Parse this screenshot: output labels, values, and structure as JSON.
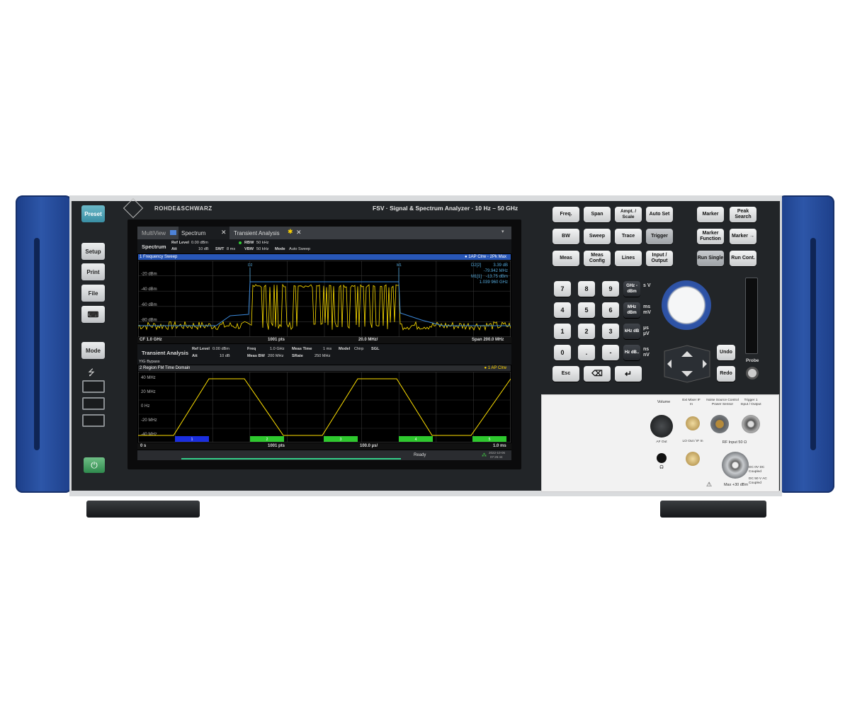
{
  "brand": "ROHDE&SCHWARZ",
  "model_title": "FSV · Signal & Spectrum Analyzer · 10 Hz – 50 GHz",
  "left_panel": {
    "preset": "Preset",
    "setup": "Setup",
    "print": "Print",
    "file": "File",
    "keyboard": "⌨",
    "mode": "Mode",
    "usb_symbol": "⭍"
  },
  "screen": {
    "tabs": [
      {
        "label": "MultiView"
      },
      {
        "label": "Spectrum"
      },
      {
        "label": "Transient Analysis"
      }
    ],
    "spectrum_header": {
      "name": "Spectrum",
      "ref_level_label": "Ref Level",
      "ref_level": "0.00 dBm",
      "att_label": "Att",
      "att": "10 dB",
      "swt_label": "SWT",
      "swt": "8 ms",
      "rbw_label": "RBW",
      "rbw": "50 kHz",
      "vbw_label": "VBW",
      "vbw": "50 kHz",
      "mode_label": "Mode",
      "mode": "Auto Sweep"
    },
    "win1": {
      "title": "1 Frequency Sweep",
      "trace_info": "● 1AP Clrw  ◦ 2Pk Max",
      "marker_readout": [
        [
          "D2[2]",
          "3.39 dB"
        ],
        [
          "",
          "-79.942 MHz"
        ],
        [
          "M1[1]",
          "-13.75 dBm"
        ],
        [
          "",
          "1.039 960 GHz"
        ]
      ],
      "y_ticks": [
        "-20 dBm",
        "-40 dBm",
        "-60 dBm",
        "-80 dBm"
      ],
      "marker_labels": [
        "D2",
        "M1"
      ],
      "footer": {
        "cf": "CF 1.0 GHz",
        "pts": "1001 pts",
        "div": "20.0 MHz/",
        "span": "Span 200.0 MHz"
      }
    },
    "transient_header": {
      "name": "Transient Analysis",
      "ref_level_label": "Ref Level",
      "ref_level": "0.00 dBm",
      "att_label": "Att",
      "att": "10 dB",
      "freq_label": "Freq",
      "freq": "1.0 GHz",
      "meas_bw_label": "Meas BW",
      "meas_bw": "200 MHz",
      "meas_time_label": "Meas Time",
      "meas_time": "1 ms",
      "srate_label": "SRate",
      "srate": "250 MHz",
      "model_label": "Model",
      "model": "Chirp",
      "sgl": "SGL",
      "yig": "YIG Bypass"
    },
    "win2": {
      "title": "2 Region FM Time Domain",
      "trace_info": "● 1 AP Clrw",
      "y_ticks": [
        "40 MHz",
        "20 MHz",
        "0 Hz",
        "-20 MHz",
        "-40 MHz"
      ],
      "regions": [
        "1",
        "2",
        "3",
        "4",
        "5"
      ],
      "footer": {
        "start": "0 s",
        "pts": "1001 pts",
        "div": "100.0 µs/",
        "stop": "1.0 ms"
      }
    },
    "status": {
      "ready": "Ready",
      "date": "2022-10-06",
      "time": "07:26:44"
    }
  },
  "keys": {
    "row1": [
      "Freq.",
      "Span",
      "Ampt. / Scale",
      "Auto Set"
    ],
    "row2": [
      "BW",
      "Sweep",
      "Trace",
      "Trigger"
    ],
    "row3": [
      "Meas",
      "Meas Config",
      "Lines",
      "Input / Output"
    ],
    "marker_keys": [
      "Marker",
      "Peak Search",
      "Marker Function",
      "Marker →",
      "Run Single",
      "Run Cont."
    ],
    "digits": [
      "7",
      "8",
      "9",
      "4",
      "5",
      "6",
      "1",
      "2",
      "3",
      "0",
      ".",
      "-"
    ],
    "unit_keys": [
      "GHz -dBm",
      "MHz dBm",
      "kHz dB",
      "Hz dB.."
    ],
    "unit_labels": [
      "s V",
      "ms mV",
      "µs µV",
      "ns nV"
    ],
    "esc": "Esc",
    "backspace": "⌫",
    "enter": "↵",
    "undo": "Undo",
    "redo": "Redo",
    "probe": "Probe"
  },
  "connectors": {
    "volume": "Volume",
    "af_out": "AF Out",
    "ext_mixer": "Ext Mixer IF In",
    "lo_out": "LO Out / IF In",
    "noise_source": "Noise Source Control Power Sensor",
    "trigger": "Trigger 1 Input / Output",
    "rf_input": "RF Input 50 Ω",
    "dc_0v": "DC 0V DC Coupled",
    "dc_50v": "DC 50 V AC Coupled",
    "max": "Max +30 dBm",
    "headphone": "🎧"
  }
}
